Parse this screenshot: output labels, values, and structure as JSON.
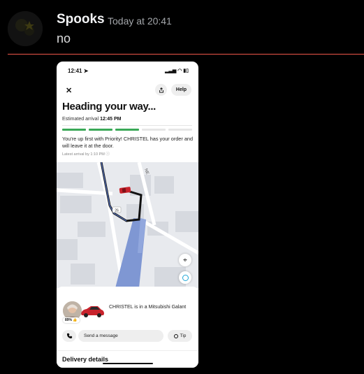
{
  "message": {
    "username": "Spooks",
    "timestamp": "Today at 20:41",
    "content": "no"
  },
  "colors": {
    "divider": "#f0574a",
    "progress_done": "#3aa857",
    "car": "#c8232c",
    "route": "#111111",
    "water": "#7f97d3"
  },
  "phone": {
    "status_time": "12:41",
    "status_icons": "signal-icon wifi-icon battery-icon",
    "header": {
      "close_icon": "close-icon",
      "share_icon": "share-icon",
      "help_label": "Help"
    },
    "title": "Heading your way...",
    "eta_label": "Estimated arrival",
    "eta_time": "12:45 PM",
    "progress": {
      "total": 5,
      "done": 3
    },
    "info_text": "You're up first with Priority! CHRISTEL has your order and will leave it at the door.",
    "latest_arrival": "Latest arrival by 1:10 PM",
    "map": {
      "street_label": "NE",
      "road_marker": "26"
    },
    "driver": {
      "rating": "89%",
      "description": "CHRISTEL is in a Mitsubishi Galant"
    },
    "message_placeholder": "Send a message",
    "tip_label": "Tip",
    "delivery_heading": "Delivery details"
  }
}
